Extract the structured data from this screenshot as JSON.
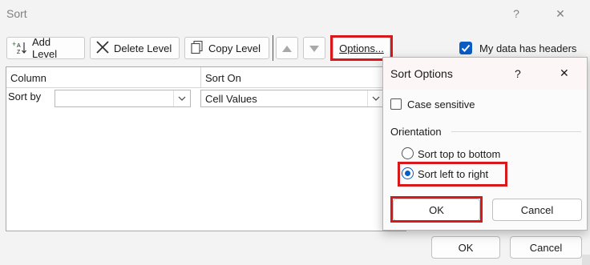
{
  "window": {
    "title": "Sort",
    "help_glyph": "?",
    "close_glyph": "✕"
  },
  "toolbar": {
    "add_level": "Add Level",
    "delete_level": "Delete Level",
    "copy_level": "Copy Level",
    "options": "Options...",
    "headers_label": "My data has headers",
    "headers_checked": true
  },
  "grid": {
    "headers": [
      "Column",
      "Sort On"
    ],
    "row": {
      "label": "Sort by",
      "column_value": "",
      "sort_on_value": "Cell Values"
    }
  },
  "footer": {
    "ok": "OK",
    "cancel": "Cancel"
  },
  "sort_options": {
    "title": "Sort Options",
    "help_glyph": "?",
    "close_glyph": "✕",
    "case_sensitive": "Case sensitive",
    "case_sensitive_checked": false,
    "orientation_label": "Orientation",
    "top_to_bottom": "Sort top to bottom",
    "left_to_right": "Sort left to right",
    "selected": "left_to_right",
    "ok": "OK",
    "cancel": "Cancel"
  },
  "colors": {
    "highlight": "#d7191c",
    "accent": "#0a5bc4"
  }
}
